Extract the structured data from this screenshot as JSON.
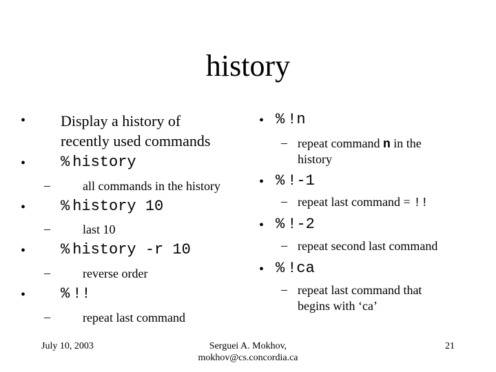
{
  "slide": {
    "title": "history",
    "left_column": [
      {
        "type": "text",
        "text_lines": [
          "Display a history of",
          "recently used commands"
        ]
      },
      {
        "type": "command",
        "prompt": "%",
        "command": "history",
        "sub": "all commands in the history"
      },
      {
        "type": "command",
        "prompt": "%",
        "command": "history 10",
        "sub": "last 10"
      },
      {
        "type": "command",
        "prompt": "%",
        "command": "history -r 10",
        "sub": "reverse order"
      },
      {
        "type": "command",
        "prompt": "%",
        "command": "!!",
        "sub": "repeat last command"
      }
    ],
    "right_column": [
      {
        "prompt": "%",
        "command": "!n",
        "sub_lines": [
          "repeat command ",
          "n",
          " in the",
          "history"
        ]
      },
      {
        "prompt": "%",
        "command": "!-1",
        "sub": "repeat last command = ",
        "sub_code": "!!"
      },
      {
        "prompt": "%",
        "command": "!-2",
        "sub": "repeat second last command"
      },
      {
        "prompt": "%",
        "command": "!ca",
        "sub_lines2": [
          "repeat last command that",
          "begins with ‘ca’"
        ]
      }
    ],
    "bullet_glyph": "•",
    "dash_glyph": "–",
    "footer": {
      "date": "July 10, 2003",
      "author_line1": "Serguei A. Mokhov,",
      "author_line2": "mokhov@cs.concordia.ca",
      "page_number": "21"
    }
  }
}
